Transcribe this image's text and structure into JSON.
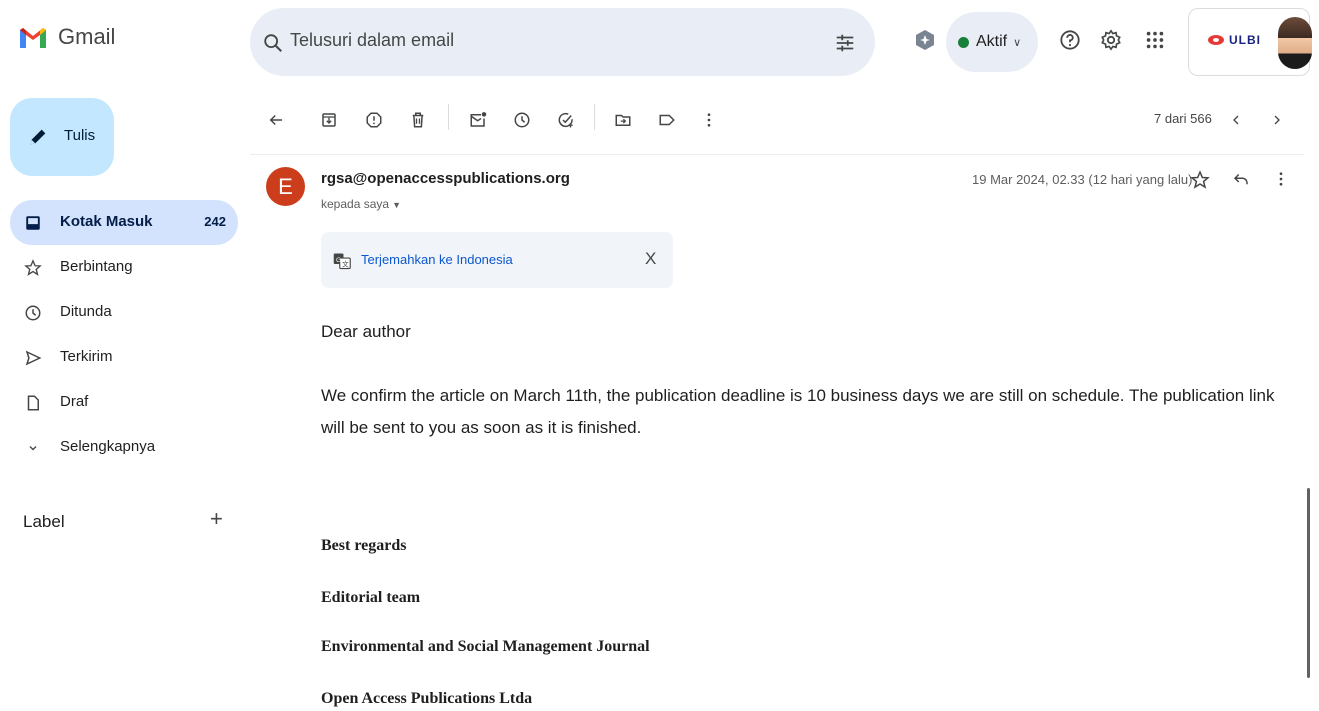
{
  "app": {
    "name": "Gmail"
  },
  "search": {
    "placeholder": "Telusuri dalam email"
  },
  "status": {
    "label": "Aktif"
  },
  "account": {
    "org_logo_text": "ULBI"
  },
  "compose": {
    "label": "Tulis"
  },
  "sidebar": {
    "items": [
      {
        "label": "Kotak Masuk",
        "count": "242",
        "icon": "inbox-icon"
      },
      {
        "label": "Berbintang",
        "icon": "star-icon"
      },
      {
        "label": "Ditunda",
        "icon": "clock-icon"
      },
      {
        "label": "Terkirim",
        "icon": "send-icon"
      },
      {
        "label": "Draf",
        "icon": "draft-icon"
      },
      {
        "label": "Selengkapnya",
        "icon": "chevron-down-icon"
      }
    ],
    "label_heading": "Label",
    "label_add": "+"
  },
  "toolbar": {
    "page_count": "7 dari 566",
    "icons": [
      "back-arrow-icon",
      "archive-icon",
      "report-spam-icon",
      "delete-icon",
      "mark-unread-icon",
      "snooze-icon",
      "add-task-icon",
      "move-to-icon",
      "label-icon",
      "more-vert-icon",
      "prev-page-icon",
      "next-page-icon"
    ]
  },
  "message": {
    "avatar_letter": "E",
    "sender": "rgsa@openaccesspublications.org",
    "recipient": "kepada saya",
    "date": "19 Mar 2024, 02.33 (12 hari yang lalu)",
    "translate_label": "Terjemahkan ke Indonesia",
    "translate_close": "X",
    "greeting": "Dear author",
    "paragraph": "We confirm the article on March 11th, the publication deadline is 10 business days we are still on schedule. The publication link will be sent to you as soon as it is finished.",
    "signature": [
      "Best regards",
      "Editorial team",
      "Environmental and Social Management Journal",
      "Open Access Publications Ltda"
    ]
  },
  "colors": {
    "compose_bg": "#c2e7ff",
    "active_nav_bg": "#d3e3fd",
    "search_bg": "#e9eef6",
    "sender_avatar": "#cc3e1b",
    "link_blue": "#0b57d0",
    "status_green": "#188038"
  }
}
